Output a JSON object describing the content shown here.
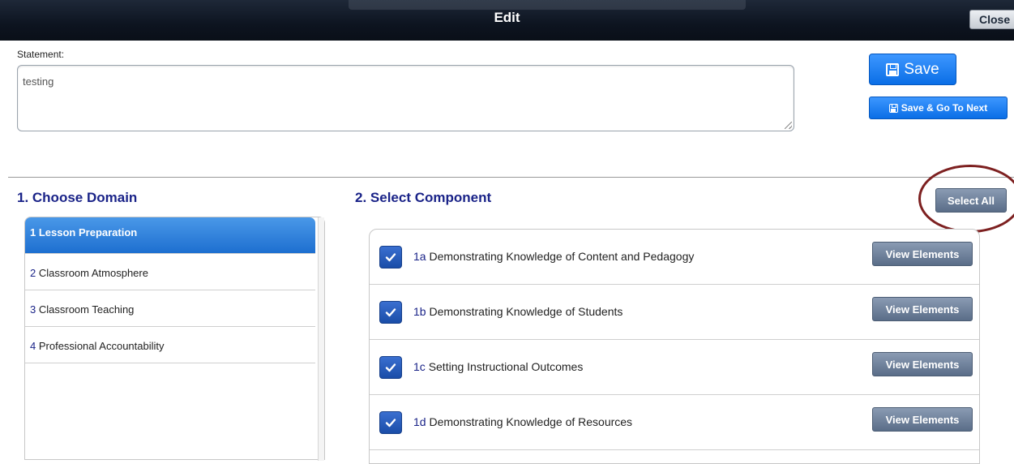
{
  "dialog": {
    "title": "Edit",
    "close_label": "Close"
  },
  "statement": {
    "label": "Statement:",
    "value": "testing"
  },
  "actions": {
    "save_label": "Save",
    "save_next_label": "Save & Go To Next"
  },
  "domain_section": {
    "heading": "1. Choose Domain",
    "items": [
      {
        "num": "1",
        "label": "Lesson Preparation",
        "selected": true
      },
      {
        "num": "2",
        "label": "Classroom Atmosphere",
        "selected": false
      },
      {
        "num": "3",
        "label": "Classroom Teaching",
        "selected": false
      },
      {
        "num": "4",
        "label": "Professional Accountability",
        "selected": false
      }
    ]
  },
  "component_section": {
    "heading": "2. Select Component",
    "select_all_label": "Select All",
    "view_label": "View Elements",
    "items": [
      {
        "code": "1a",
        "label": "Demonstrating Knowledge of Content and Pedagogy",
        "checked": true
      },
      {
        "code": "1b",
        "label": "Demonstrating Knowledge of Students",
        "checked": true
      },
      {
        "code": "1c",
        "label": "Setting Instructional Outcomes",
        "checked": true
      },
      {
        "code": "1d",
        "label": "Demonstrating Knowledge of Resources",
        "checked": true
      }
    ]
  },
  "colors": {
    "heading": "#1a2388",
    "primary": "#0a6ee6",
    "annotation": "#7d2020"
  },
  "icons": {
    "save": "floppy-disk-icon",
    "check": "checkmark-icon"
  }
}
